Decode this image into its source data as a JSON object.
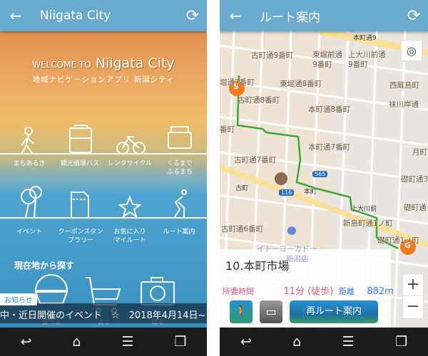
{
  "left": {
    "header": {
      "title": "Niigata City",
      "back_icon": "arrow-left-icon",
      "refresh_icon": "refresh-icon"
    },
    "welcome": {
      "prefix": "WELCOME TO",
      "name": "Niigata City",
      "subtitle": "地域ナビゲーションアプリ 新潟シティ"
    },
    "menu": [
      {
        "label": "まちあるき",
        "icon": "walker-icon"
      },
      {
        "label": "観光循環バス",
        "icon": "bus-icon"
      },
      {
        "label": "レンタサイクル",
        "icon": "bicycle-icon"
      },
      {
        "label": "くるまでふるまち",
        "icon": "car-icon"
      },
      {
        "label": "イベント",
        "icon": "balloons-icon"
      },
      {
        "label": "クーポンスタンプラリー",
        "icon": "coupon-icon"
      },
      {
        "label": "お気に入りマイルート",
        "icon": "star-icon"
      },
      {
        "label": "ルート案内",
        "icon": "route-runner-icon"
      }
    ],
    "nearby": {
      "title": "現在地から探す",
      "items": [
        {
          "label": "食べる",
          "icon": "rice-bowl-icon"
        },
        {
          "label": "買う",
          "icon": "cart-icon"
        },
        {
          "label": "観る",
          "icon": "camera-icon"
        }
      ]
    },
    "notice": {
      "badge": "お知らせ",
      "text": "中・近日開催のイベント　☆　2018年4月14日~"
    }
  },
  "right": {
    "header": {
      "title": "ルート案内"
    },
    "map_labels": [
      "本町通9",
      "古町通9番町",
      "東堀前通9番町",
      "上大川前通9番町",
      "堀通7番町",
      "東堀通8番町",
      "西厩島町",
      "古町通8番町",
      "袜川岸通",
      "本町通8番町",
      "番町",
      "本町通7番町",
      "月町",
      "古町通7番町",
      "礎町通3",
      "古町",
      "本町",
      "上大川前",
      "礎町通",
      "新島町通1ノ町",
      "古町通6番町",
      "礎町通1ノ町",
      "イトーヨーカドー",
      "新潟店"
    ],
    "road_badges": [
      "565",
      "116"
    ],
    "markers": {
      "start": "S",
      "goal": "G"
    },
    "destination": "10.本町市場",
    "time_label": "所要時間",
    "time_value": "11分 (徒歩)",
    "distance_label": "距離",
    "distance_value": "882m",
    "reroute_button": "再ルート案内",
    "zoom_in": "+",
    "zoom_out": "−",
    "colors": {
      "route": "#3aaa35",
      "marker": "#f07a1c",
      "header": "#6aaacd"
    }
  }
}
